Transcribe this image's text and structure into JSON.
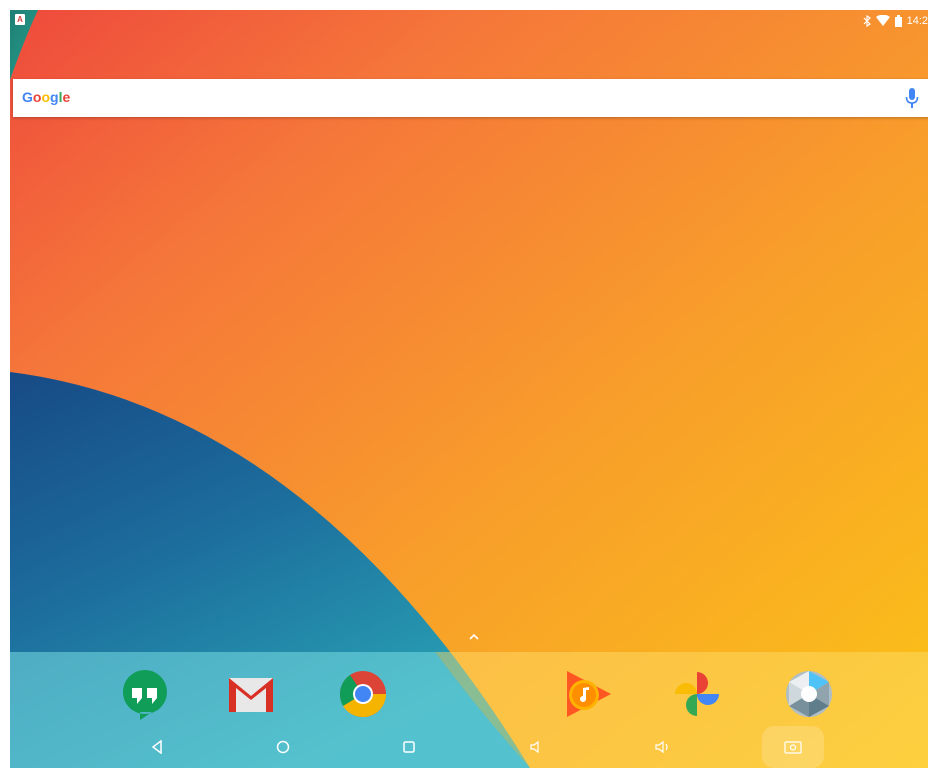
{
  "statusbar": {
    "time": "14:2",
    "icons": [
      "notification-icon",
      "bluetooth-icon",
      "wifi-icon",
      "battery-icon"
    ]
  },
  "search": {
    "logo": "Google",
    "icon": "microphone-icon"
  },
  "app_drawer": {
    "icon": "chevron-up-icon"
  },
  "dock": {
    "apps": [
      "hangouts",
      "gmail",
      "chrome",
      "play-music",
      "photos",
      "camera"
    ]
  },
  "nav": {
    "buttons": [
      "back",
      "home",
      "recents",
      "volume-down",
      "volume-up",
      "screenshot"
    ]
  },
  "colors": {
    "wallpaper_orange": "#f79a2c",
    "wallpaper_blue": "#1e6d9a",
    "search_bg": "#ffffff"
  }
}
